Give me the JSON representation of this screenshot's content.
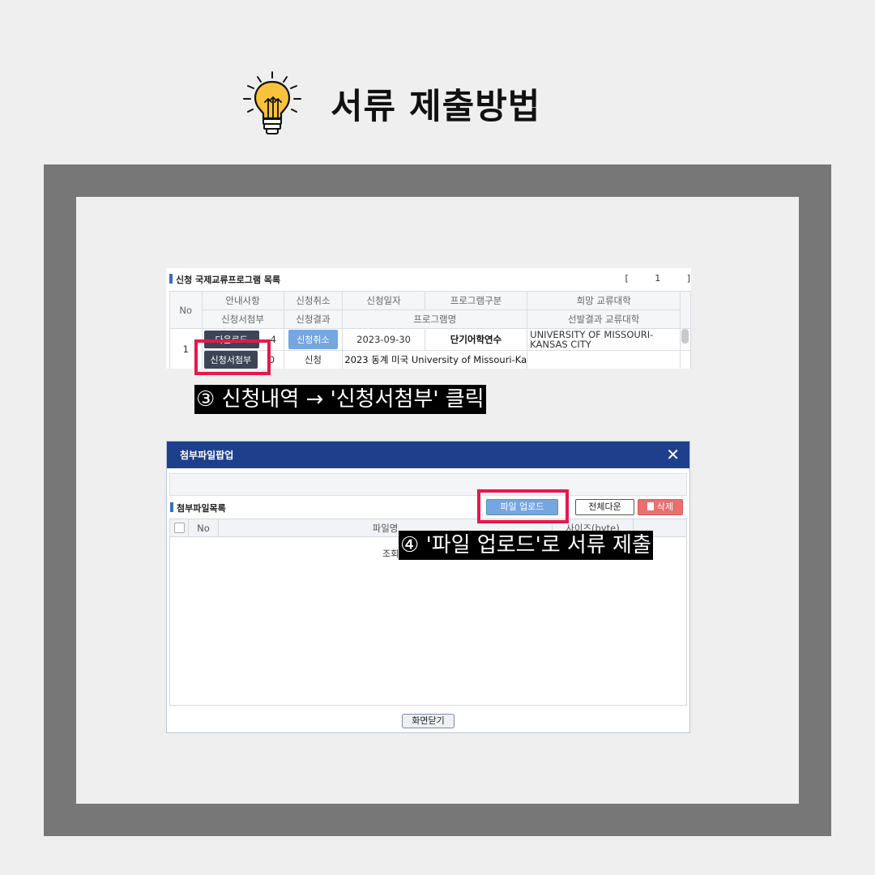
{
  "header": {
    "title": "서류 제출방법",
    "icon": "lightbulb-icon",
    "icon_color": "#f9c23c"
  },
  "colors": {
    "frame": "#777777",
    "highlight": "#e8174a",
    "popup_header": "#1e3f8c",
    "accent_button": "#75a6e0"
  },
  "application_list": {
    "title": "신청 국제교류프로그램 목록",
    "pager": [
      "[",
      "1",
      "]"
    ],
    "header_row1": [
      "No",
      "안내사항",
      "신청취소",
      "신청일자",
      "프로그램구분",
      "희망 교류대학"
    ],
    "header_row2": [
      "신청서첨부",
      "신청결과",
      "프로그램명",
      "선발결과 교류대학"
    ],
    "row": {
      "no": "1",
      "download_button": "다운로드",
      "count_top": "4",
      "cancel_button": "신청취소",
      "date": "2023-09-30",
      "program_type": "단기어학연수",
      "university": "UNIVERSITY OF MISSOURI-KANSAS CITY",
      "attach_button": "신청서첨부",
      "count_bottom": "0",
      "result": "신청",
      "program_name": "2023 동계 미국 University of Missouri-Ka"
    }
  },
  "step3_caption": "③ 신청내역 → '신청서첨부' 클릭",
  "popup": {
    "title": "첨부파일팝업",
    "close_icon": "close-icon",
    "files_title": "첨부파일목록",
    "upload_button": "파일 업로드",
    "download_all_button": "전체다운",
    "delete_button": "삭제",
    "columns": [
      "No",
      "파일명",
      "사이즈(byte)"
    ],
    "empty_message": "조회",
    "close_button": "화면닫기"
  },
  "step4_caption": "④ '파일 업로드'로 서류 제출"
}
